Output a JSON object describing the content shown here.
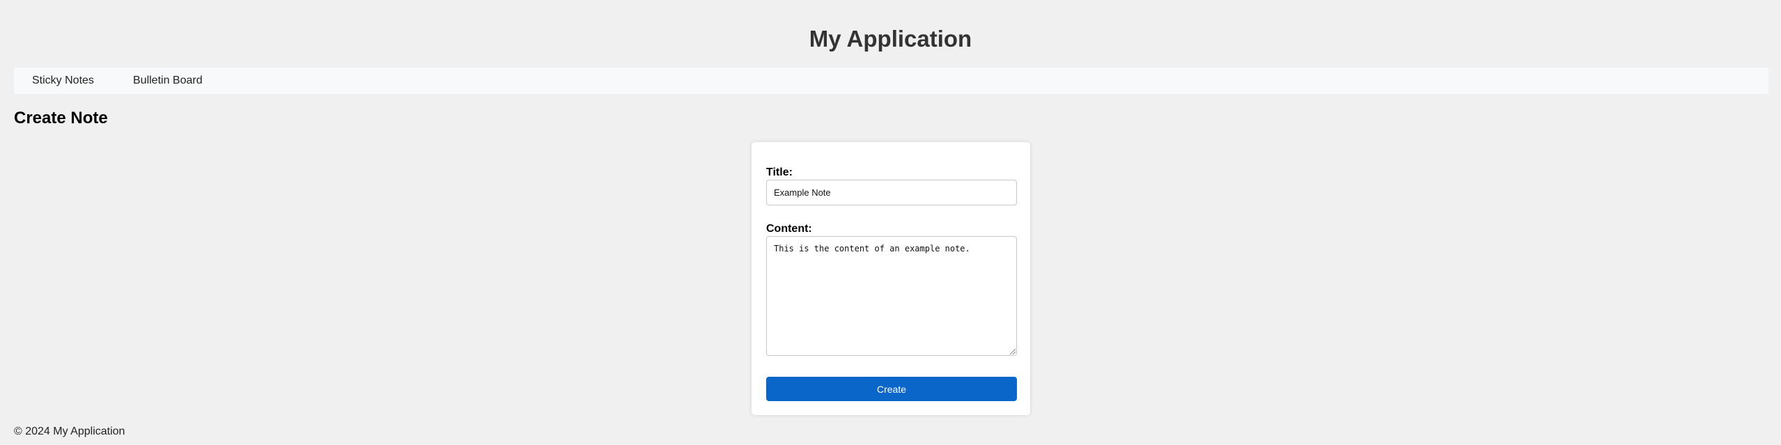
{
  "app": {
    "title": "My Application"
  },
  "nav": {
    "items": [
      {
        "label": "Sticky Notes"
      },
      {
        "label": "Bulletin Board"
      }
    ]
  },
  "main": {
    "heading": "Create Note"
  },
  "form": {
    "title_label": "Title:",
    "title_value": "Example Note",
    "content_label": "Content:",
    "content_value": "This is the content of an example note.",
    "submit_label": "Create"
  },
  "footer": {
    "text": "© 2024 My Application"
  },
  "colors": {
    "background": "#f0f0f0",
    "nav_background": "#f8f9fa",
    "button": "#0a66c8",
    "card": "#ffffff"
  }
}
